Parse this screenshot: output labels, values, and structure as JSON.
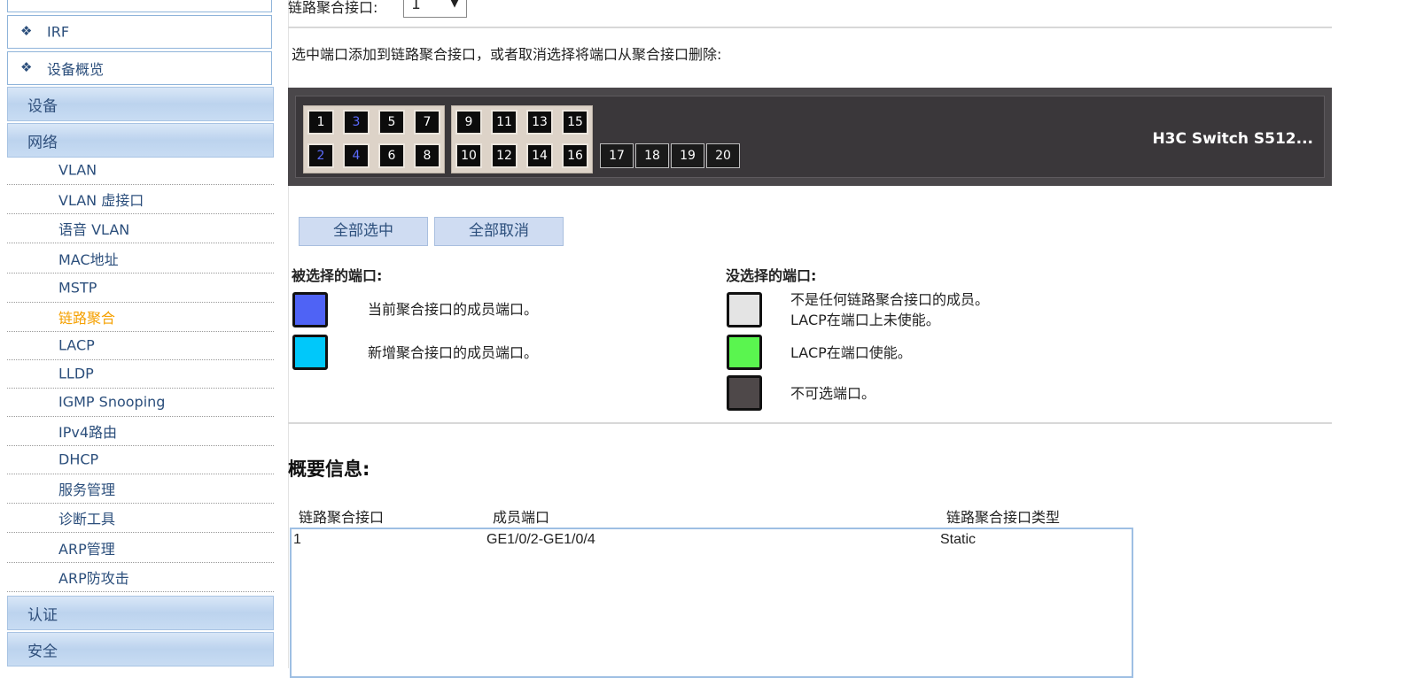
{
  "sidebar": {
    "top_items": [
      {
        "label": "IRF"
      },
      {
        "label": "设备概览"
      }
    ],
    "categories": {
      "device": "设备",
      "network": "网络",
      "auth": "认证",
      "security": "安全"
    },
    "network_items": [
      {
        "label": "VLAN"
      },
      {
        "label": "VLAN 虚接口"
      },
      {
        "label": "语音 VLAN"
      },
      {
        "label": "MAC地址"
      },
      {
        "label": "MSTP"
      },
      {
        "label": "链路聚合",
        "active": true
      },
      {
        "label": "LACP"
      },
      {
        "label": "LLDP"
      },
      {
        "label": "IGMP Snooping"
      },
      {
        "label": "IPv4路由"
      },
      {
        "label": "DHCP"
      },
      {
        "label": "服务管理"
      },
      {
        "label": "诊断工具"
      },
      {
        "label": "ARP管理"
      },
      {
        "label": "ARP防攻击"
      }
    ]
  },
  "aggregation": {
    "interface_label": "链路聚合接口:",
    "interface_value": "1",
    "instruction": "选中端口添加到链路聚合接口，或者取消选择将端口从聚合接口删除:"
  },
  "switch": {
    "name": "H3C Switch S512...",
    "ports_top": [
      "1",
      "3",
      "5",
      "7",
      "9",
      "11",
      "13",
      "15"
    ],
    "ports_bottom": [
      "2",
      "4",
      "6",
      "8",
      "10",
      "12",
      "14",
      "16"
    ],
    "ports_extra": [
      "17",
      "18",
      "19",
      "20"
    ],
    "member_ports": [
      "2",
      "3",
      "4"
    ]
  },
  "buttons": {
    "select_all": "全部选中",
    "deselect_all": "全部取消"
  },
  "legend": {
    "selected_title": "被选择的端口:",
    "unselected_title": "没选择的端口:",
    "selected": [
      {
        "color": "#4f63f5",
        "text": "当前聚合接口的成员端口。"
      },
      {
        "color": "#00c8fa",
        "text": "新增聚合接口的成员端口。"
      }
    ],
    "unselected": [
      {
        "color": "#e4e4e4",
        "line1": "不是任何链路聚合接口的成员。",
        "line2": "LACP在端口上未使能。"
      },
      {
        "color": "#5af54f",
        "line1": "LACP在端口使能。"
      },
      {
        "color": "#4e4849",
        "line1": "不可选端口。"
      }
    ]
  },
  "summary": {
    "title": "概要信息:",
    "columns": [
      "链路聚合接口",
      "成员端口",
      "链路聚合接口类型"
    ],
    "rows": [
      [
        "1",
        "GE1/0/2-GE1/0/4",
        "Static"
      ]
    ]
  }
}
